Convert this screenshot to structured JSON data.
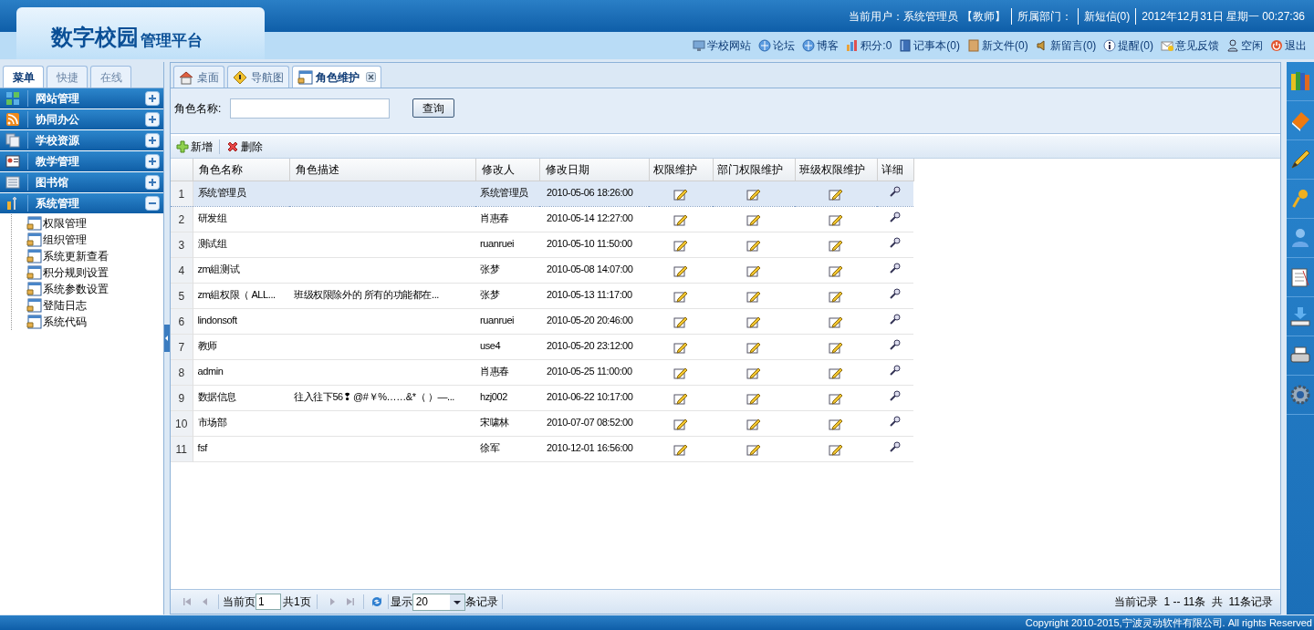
{
  "header": {
    "logo_title": "数字校园",
    "logo_subtitle": "管理平台",
    "status": [
      "当前用户：系统管理员 【教师】",
      "所属部门：",
      "新短信(0)",
      "2012年12月31日 星期一 00:27:36"
    ],
    "links": [
      {
        "label": "学校网站"
      },
      {
        "label": "论坛"
      },
      {
        "label": "博客"
      },
      {
        "label": "积分:0"
      },
      {
        "label": "记事本(0)"
      },
      {
        "label": "新文件(0)"
      },
      {
        "label": "新留言(0)"
      },
      {
        "label": "提醒(0)"
      },
      {
        "label": "意见反馈"
      },
      {
        "label": "空闲"
      },
      {
        "label": "退出"
      }
    ]
  },
  "sidebar": {
    "tabs": [
      {
        "label": "菜单",
        "selected": true
      },
      {
        "label": "快捷",
        "selected": false
      },
      {
        "label": "在线",
        "selected": false
      }
    ],
    "groups": [
      {
        "label": "网站管理",
        "expanded": false
      },
      {
        "label": "协同办公",
        "expanded": false
      },
      {
        "label": "学校资源",
        "expanded": false
      },
      {
        "label": "教学管理",
        "expanded": false
      },
      {
        "label": "图书馆",
        "expanded": false
      },
      {
        "label": "系统管理",
        "expanded": true,
        "children": [
          {
            "label": "权限管理"
          },
          {
            "label": "组织管理"
          },
          {
            "label": "系统更新查看"
          },
          {
            "label": "积分规则设置"
          },
          {
            "label": "系统参数设置"
          },
          {
            "label": "登陆日志"
          },
          {
            "label": "系统代码"
          }
        ]
      }
    ]
  },
  "tabs": [
    {
      "label": "桌面",
      "selected": false,
      "closable": false
    },
    {
      "label": "导航图",
      "selected": false,
      "closable": false
    },
    {
      "label": "角色维护",
      "selected": true,
      "closable": true
    }
  ],
  "search": {
    "label": "角色名称:",
    "button": "查询"
  },
  "toolbar": [
    {
      "label": "新增",
      "kind": "add"
    },
    {
      "label": "删除",
      "kind": "delete"
    }
  ],
  "table": {
    "columns": [
      "角色名称",
      "角色描述",
      "修改人",
      "修改日期",
      "权限维护",
      "部门权限维护",
      "班级权限维护",
      "详细"
    ],
    "rows": [
      {
        "index": "1",
        "name": "系统管理员",
        "description": "",
        "modifier": "系统管理员",
        "date": "2010-05-06 18:26:00",
        "selected": true
      },
      {
        "index": "2",
        "name": "研发组",
        "description": "",
        "modifier": "肖惠春",
        "date": "2010-05-14 12:27:00",
        "selected": false
      },
      {
        "index": "3",
        "name": "测试组",
        "description": "",
        "modifier": "ruanruei",
        "date": "2010-05-10 11:50:00",
        "selected": false
      },
      {
        "index": "4",
        "name": "zm組测试",
        "description": "",
        "modifier": "张梦",
        "date": "2010-05-08 14:07:00",
        "selected": false
      },
      {
        "index": "5",
        "name": "zm組权限（ ALL...",
        "description": "班级权限除外的  所有的功能都在...",
        "modifier": "张梦",
        "date": "2010-05-13 11:17:00",
        "selected": false
      },
      {
        "index": "6",
        "name": "lindonsoft",
        "description": "",
        "modifier": "ruanruei",
        "date": "2010-05-20 20:46:00",
        "selected": false
      },
      {
        "index": "7",
        "name": "教师",
        "description": "",
        "modifier": "use4",
        "date": "2010-05-20 23:12:00",
        "selected": false
      },
      {
        "index": "8",
        "name": "admin",
        "description": "",
        "modifier": "肖惠春",
        "date": "2010-05-25 11:00:00",
        "selected": false
      },
      {
        "index": "9",
        "name": "数据信息",
        "description": "往入往下56❢  @#￥%……&*（ ）—...",
        "modifier": "hzj002",
        "date": "2010-06-22 10:17:00",
        "selected": false
      },
      {
        "index": "10",
        "name": "市场部",
        "description": "",
        "modifier": "宋啸林",
        "date": "2010-07-07 08:52:00",
        "selected": false
      },
      {
        "index": "11",
        "name": "fsf",
        "description": "",
        "modifier": "徐军",
        "date": "2010-12-01 16:56:00",
        "selected": false
      }
    ]
  },
  "pager": {
    "page_label": "当前页",
    "page": "1",
    "total_pages": "共1页",
    "show_label": "显示",
    "page_size": "20",
    "records_label": "条记录",
    "summary": "当前记录  1 -- 11条  共  11条记录"
  },
  "footer": "Copyright 2010-2015,宁波灵动软件有限公司. All rights Reserved"
}
